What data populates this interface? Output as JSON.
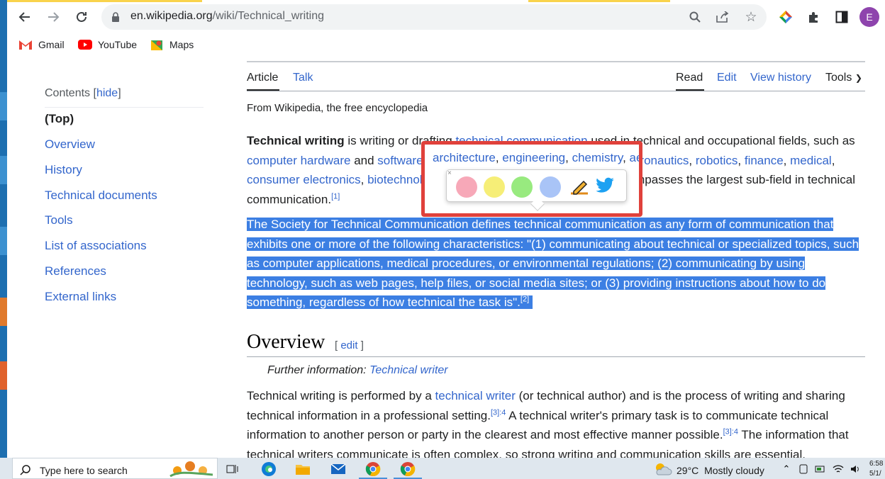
{
  "browser": {
    "url_host": "en.wikipedia.org",
    "url_path": "/wiki/Technical_writing",
    "avatar_letter": "E",
    "bookmarks": [
      {
        "label": "Gmail",
        "icon": "gmail-icon"
      },
      {
        "label": "YouTube",
        "icon": "youtube-icon"
      },
      {
        "label": "Maps",
        "icon": "maps-icon"
      }
    ]
  },
  "toc": {
    "title": "Contents",
    "hide_label": "hide",
    "items": [
      "(Top)",
      "Overview",
      "History",
      "Technical documents",
      "Tools",
      "List of associations",
      "References",
      "External links"
    ]
  },
  "tabs": {
    "article": "Article",
    "talk": "Talk",
    "read": "Read",
    "edit": "Edit",
    "history": "View history",
    "tools": "Tools"
  },
  "article": {
    "from": "From Wikipedia, the free encyclopedia",
    "p1": {
      "bold": "Technical writing",
      "t1": " is writing or drafting ",
      "l1": "technical communication",
      "t2": " used in technical and occupational fields, such as ",
      "l2": "computer hardware",
      "t3": " and ",
      "l3": "software",
      "t4": ", ",
      "l4": "architecture",
      "l5": "engineering",
      "l6": "chemistry",
      "l7": "aeronautics",
      "l8": "robotics",
      "l9": "finance",
      "l10": "medical",
      "l11": "consumer electronics",
      "l12": "biotechnology",
      "t5": ", and forestry. Technical writing encompasses the largest sub-field in technical communication.",
      "ref": "[1]"
    },
    "p2": {
      "text": "The Society for Technical Communication defines technical communication as any form of communication that exhibits one or more of the following characteristics: \"(1) communicating about technical or specialized topics, such as computer applications, medical procedures, or environmental regulations; (2) communicating by using technology, such as web pages, help files, or social media sites; or (3) providing instructions about how to do something, regardless of how technical the task is\".",
      "ref": "[2]"
    },
    "overview": {
      "heading": "Overview",
      "edit": "edit",
      "further_label": "Further information: ",
      "further_link": "Technical writer"
    },
    "p3": {
      "t1": "Technical writing is performed by a ",
      "l1": "technical writer",
      "t2": " (or technical author) and is the process of writing and sharing technical information in a professional setting.",
      "ref1": "[3]:4",
      "t3": " A technical writer's primary task is to communicate technical information to another person or party in the clearest and most effective manner possible.",
      "ref2": "[3]:4",
      "t4": " The information that technical writers communicate is often complex, so strong writing and communication skills are essential."
    }
  },
  "highlighter_popup": {
    "colors": [
      "#f7a8b8",
      "#f6ee77",
      "#98ea7f",
      "#a9c4f7"
    ],
    "close": "×"
  },
  "taskbar": {
    "search_placeholder": "Type here to search",
    "weather_temp": "29°C",
    "weather_desc": "Mostly cloudy",
    "time": "6:58",
    "date": "5/1/"
  }
}
